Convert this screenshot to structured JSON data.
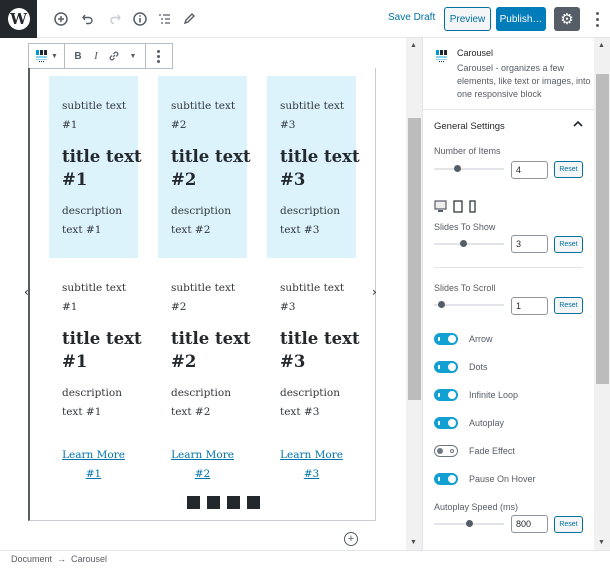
{
  "topbar": {
    "save_draft": "Save Draft",
    "preview": "Preview",
    "publish": "Publish…",
    "icons": [
      "add-block-icon",
      "undo-icon",
      "redo-icon",
      "info-icon",
      "outline-icon",
      "edit-icon"
    ]
  },
  "block_toolbar": {
    "bold": "B",
    "italic": "I"
  },
  "slides_row1": [
    {
      "subtitle": "subtitle text #1",
      "title": "title text #1",
      "description": "description text #1"
    },
    {
      "subtitle": "subtitle text #2",
      "title": "title text #2",
      "description": "description text #2"
    },
    {
      "subtitle": "subtitle text #3",
      "title": "title text #3",
      "description": "description text #3"
    }
  ],
  "slides_row2": [
    {
      "subtitle": "subtitle text #1",
      "title": "title text #1",
      "description": "description text #1",
      "link": "Learn More #1"
    },
    {
      "subtitle": "subtitle text #2",
      "title": "title text #2",
      "description": "description text #2",
      "link": "Learn More #2"
    },
    {
      "subtitle": "subtitle text #3",
      "title": "title text #3",
      "description": "description text #3",
      "link": "Learn More #3"
    }
  ],
  "carousel": {
    "prev_arrow": "‹",
    "next_arrow": "›",
    "dot_count": 4
  },
  "sidebar": {
    "block_name": "Carousel",
    "block_description": "Carousel - organizes a few elements, like text or images, into one responsive block",
    "panel_title": "General Settings",
    "number_of_items": {
      "label": "Number of Items",
      "value": "4",
      "reset": "Reset"
    },
    "slides_to_show": {
      "label": "Slides To Show",
      "value": "3",
      "reset": "Reset"
    },
    "slides_to_scroll": {
      "label": "Slides To Scroll",
      "value": "1",
      "reset": "Reset"
    },
    "toggles": [
      {
        "label": "Arrow",
        "on": true
      },
      {
        "label": "Dots",
        "on": true
      },
      {
        "label": "Infinite Loop",
        "on": true
      },
      {
        "label": "Autoplay",
        "on": true
      },
      {
        "label": "Fade Effect",
        "on": false
      },
      {
        "label": "Pause On Hover",
        "on": true
      }
    ],
    "autoplay_speed": {
      "label": "Autoplay Speed (ms)",
      "value": "800",
      "reset": "Reset"
    }
  },
  "footer": {
    "breadcrumb": [
      "Document",
      "→",
      "Carousel"
    ]
  }
}
